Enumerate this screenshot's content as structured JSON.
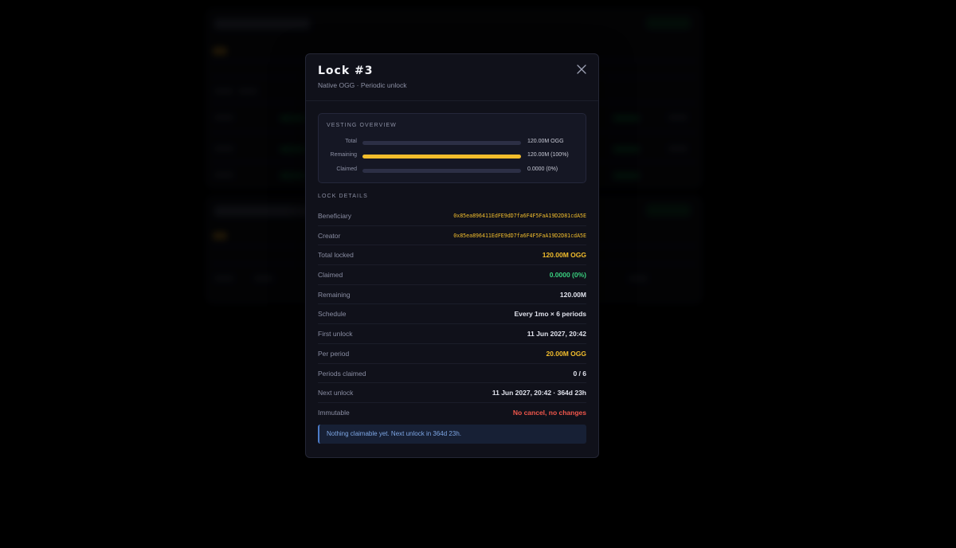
{
  "modal": {
    "title": "Lock #3",
    "subtitle": "Native OGG · Periodic unlock",
    "close_icon": "close-icon"
  },
  "overview": {
    "label": "VESTING OVERVIEW",
    "rows": [
      {
        "label": "Total",
        "value": "120.00M OGG",
        "fill_fraction": 0
      },
      {
        "label": "Remaining",
        "value": "120.00M (100%)",
        "fill_fraction": 1
      },
      {
        "label": "Claimed",
        "value": "0.0000 (0%)",
        "fill_fraction": 0
      }
    ],
    "fill_color": "#f2bd2c"
  },
  "details": {
    "label": "LOCK DETAILS",
    "rows": [
      {
        "key": "Beneficiary",
        "value": "0x85ea896411EdFE9dD7fa6F4F5FaA19D2D81cdA5E",
        "style": "mono gold"
      },
      {
        "key": "Creator",
        "value": "0x85ea896411EdFE9dD7fa6F4F5FaA19D2D81cdA5E",
        "style": "mono gold"
      },
      {
        "key": "Total locked",
        "value": "120.00M OGG",
        "style": "gold"
      },
      {
        "key": "Claimed",
        "value": "0.0000 (0%)",
        "style": "green"
      },
      {
        "key": "Remaining",
        "value": "120.00M",
        "style": ""
      },
      {
        "key": "Schedule",
        "value": "Every 1mo × 6 periods",
        "style": ""
      },
      {
        "key": "First unlock",
        "value": "11 Jun 2027, 20:42",
        "style": ""
      },
      {
        "key": "Per period",
        "value": "20.00M OGG",
        "style": "gold"
      },
      {
        "key": "Periods claimed",
        "value": "0 / 6",
        "style": ""
      },
      {
        "key": "Next unlock",
        "value": "11 Jun 2027, 20:42 · 364d 23h",
        "style": ""
      },
      {
        "key": "Immutable",
        "value": "No cancel, no changes",
        "style": "red"
      }
    ]
  },
  "notice": {
    "text": "Nothing claimable yet. Next unlock in 364d 23h."
  },
  "colors": {
    "accent_gold": "#f2bd2c",
    "accent_green": "#39d17f",
    "accent_red": "#f0564b",
    "notice_blue": "#7da6e4"
  }
}
